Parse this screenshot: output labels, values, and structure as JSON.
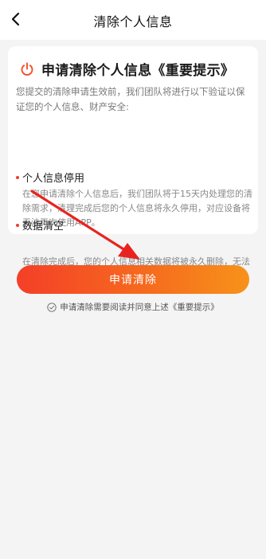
{
  "header": {
    "title": "清除个人信息"
  },
  "card": {
    "title": "申请清除个人信息《重要提示》",
    "intro": "您提交的清除申请生效前，我们团队将进行以下验证以保证您的个人信息、财产安全:",
    "sections": [
      {
        "title": "个人信息停用",
        "body": "在您申请清除个人信息后，我们团队将于15天内处理您的清除需求，清理完成后您的个人信息将永久停用，对应设备将无法再次使用APP。"
      },
      {
        "title": "数据清空",
        "body": "在清除完成后，您的个人信息相关数据将被永久删除，无法再找回恢复，请您审慎操作。"
      }
    ]
  },
  "actions": {
    "apply_label": "申请清除"
  },
  "agreement": {
    "text": "申请清除需要阅读并同意上述《重要提示》"
  },
  "colors": {
    "accent": "#f4502a",
    "bullet": "#e8402b",
    "annotation_arrow": "#e8231f"
  }
}
